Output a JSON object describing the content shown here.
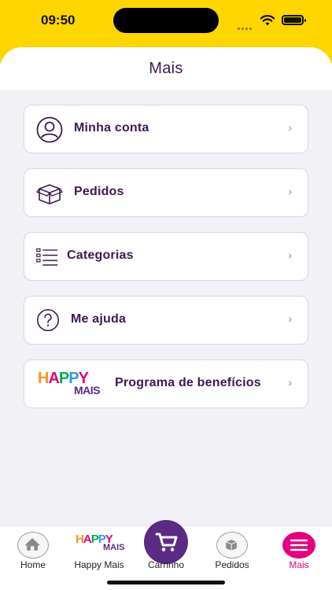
{
  "status_bar": {
    "time": "09:50"
  },
  "header": {
    "title": "Mais"
  },
  "menu": [
    {
      "label": "Minha conta",
      "icon": "user-circle-icon"
    },
    {
      "label": "Pedidos",
      "icon": "box-icon"
    },
    {
      "label": "Categorias",
      "icon": "list-icon"
    },
    {
      "label": "Me ajuda",
      "icon": "help-circle-icon"
    },
    {
      "label": "Programa de benefícios",
      "icon": "happy-mais-logo",
      "logo_text": "HAPPY",
      "logo_sub": "MAIS"
    }
  ],
  "chevron": "›",
  "tabbar": {
    "tabs": [
      {
        "label": "Home",
        "icon": "home-icon"
      },
      {
        "label": "Happy Mais",
        "icon": "happy-mais-logo",
        "logo_text": "HAPPY",
        "logo_sub": "MAIS"
      },
      {
        "label": "Carrinho",
        "icon": "cart-icon"
      },
      {
        "label": "Pedidos",
        "icon": "box-icon"
      },
      {
        "label": "Mais",
        "icon": "menu-icon"
      }
    ],
    "active": "Mais"
  },
  "colors": {
    "brand_yellow": "#FFD600",
    "brand_purple": "#5B2A86",
    "accent_pink": "#E4007C",
    "text_dark_purple": "#3D1A52"
  }
}
